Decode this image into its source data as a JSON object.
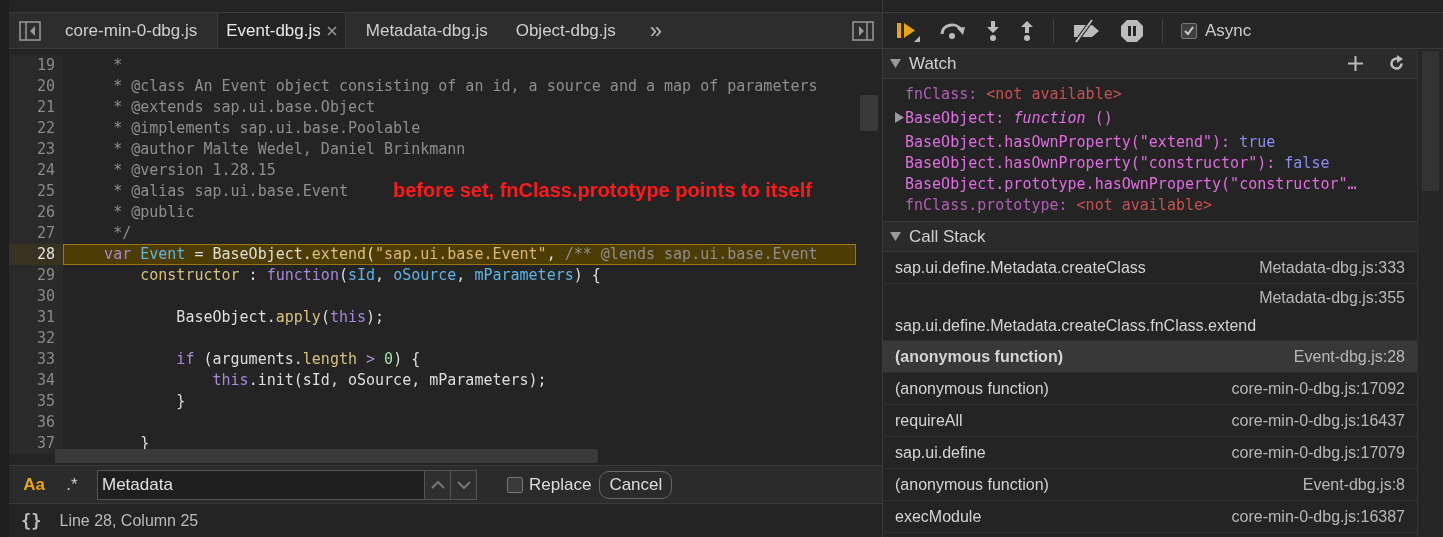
{
  "editor": {
    "tabs": [
      {
        "label": "core-min-0-dbg.js",
        "selected": false
      },
      {
        "label": "Event-dbg.js",
        "selected": true
      },
      {
        "label": "Metadata-dbg.js",
        "selected": false
      },
      {
        "label": "Object-dbg.js",
        "selected": false
      }
    ],
    "more_tabs": "»",
    "lines": [
      {
        "number": "19",
        "current": false,
        "tokens": [
          {
            "kind": "comment",
            "t": "     *"
          }
        ]
      },
      {
        "number": "20",
        "current": false,
        "tokens": [
          {
            "kind": "comment",
            "t": "     * @class An Event object consisting of an id, a source and a map of parameters"
          }
        ]
      },
      {
        "number": "21",
        "current": false,
        "tokens": [
          {
            "kind": "comment",
            "t": "     * @extends sap.ui.base.Object"
          }
        ]
      },
      {
        "number": "22",
        "current": false,
        "tokens": [
          {
            "kind": "comment",
            "t": "     * @implements sap.ui.base.Poolable"
          }
        ]
      },
      {
        "number": "23",
        "current": false,
        "tokens": [
          {
            "kind": "comment",
            "t": "     * @author Malte Wedel, Daniel Brinkmann"
          }
        ]
      },
      {
        "number": "24",
        "current": false,
        "tokens": [
          {
            "kind": "comment",
            "t": "     * @version 1.28.15"
          }
        ]
      },
      {
        "number": "25",
        "current": false,
        "tokens": [
          {
            "kind": "comment",
            "t": "     * @alias sap.ui.base.Event"
          }
        ]
      },
      {
        "number": "26",
        "current": false,
        "tokens": [
          {
            "kind": "comment",
            "t": "     * @public"
          }
        ]
      },
      {
        "number": "27",
        "current": false,
        "tokens": [
          {
            "kind": "comment",
            "t": "     */"
          }
        ]
      },
      {
        "number": "28",
        "current": true,
        "tokens": [
          {
            "kind": "keyword",
            "t": "    var "
          },
          {
            "kind": "ident",
            "t": "Event"
          },
          {
            "kind": "plain",
            "t": " = BaseObject."
          },
          {
            "kind": "prop",
            "t": "extend"
          },
          {
            "kind": "plain",
            "t": "("
          },
          {
            "kind": "string",
            "t": "\"sap.ui.base.Event\""
          },
          {
            "kind": "plain",
            "t": ", "
          },
          {
            "kind": "comment",
            "t": "/** @lends sap.ui.base.Event"
          }
        ]
      },
      {
        "number": "29",
        "current": false,
        "tokens": [
          {
            "kind": "prop",
            "t": "        constructor"
          },
          {
            "kind": "plain",
            "t": " : "
          },
          {
            "kind": "keyword",
            "t": "function"
          },
          {
            "kind": "plain",
            "t": "("
          },
          {
            "kind": "ident",
            "t": "sId"
          },
          {
            "kind": "plain",
            "t": ", "
          },
          {
            "kind": "ident",
            "t": "oSource"
          },
          {
            "kind": "plain",
            "t": ", "
          },
          {
            "kind": "ident",
            "t": "mParameters"
          },
          {
            "kind": "plain",
            "t": ") {"
          }
        ]
      },
      {
        "number": "30",
        "current": false
      },
      {
        "number": "31",
        "current": false,
        "tokens": [
          {
            "kind": "plain",
            "t": "            BaseObject."
          },
          {
            "kind": "prop",
            "t": "apply"
          },
          {
            "kind": "plain",
            "t": "("
          },
          {
            "kind": "keyword",
            "t": "this"
          },
          {
            "kind": "plain",
            "t": ");"
          }
        ]
      },
      {
        "number": "32",
        "current": false
      },
      {
        "number": "33",
        "current": false,
        "tokens": [
          {
            "kind": "keyword",
            "t": "            if"
          },
          {
            "kind": "plain",
            "t": " (arguments."
          },
          {
            "kind": "prop",
            "t": "length"
          },
          {
            "kind": "keyword",
            "t": " > "
          },
          {
            "kind": "number",
            "t": "0"
          },
          {
            "kind": "plain",
            "t": ") {"
          }
        ]
      },
      {
        "number": "34",
        "current": false,
        "tokens": [
          {
            "kind": "keyword",
            "t": "                this"
          },
          {
            "kind": "plain",
            "t": ".init(sId, oSource, mParameters);"
          }
        ]
      },
      {
        "number": "35",
        "current": false,
        "tokens": [
          {
            "kind": "plain",
            "t": "            }"
          }
        ]
      },
      {
        "number": "36",
        "current": false
      },
      {
        "number": "37",
        "current": false,
        "tokens": [
          {
            "kind": "plain",
            "t": "        }"
          }
        ]
      }
    ],
    "annotation": "before set, fnClass.prototype points to itself",
    "search": {
      "match_case": {
        "label": "Aa",
        "on": true
      },
      "regex": {
        "label": ".*",
        "on": false
      },
      "value": "Metadata",
      "replace": {
        "label": "Replace",
        "checked": false
      },
      "cancel": "Cancel"
    },
    "status": {
      "format": "{}",
      "position": "Line 28, Column 25"
    }
  },
  "debugger": {
    "async": {
      "label": "Async",
      "checked": true
    },
    "watch": {
      "title": "Watch",
      "items": [
        {
          "kind": "unavailable",
          "name": "fnClass:",
          "value": "<not available>",
          "expandable": false
        },
        {
          "kind": "value",
          "name": "BaseObject:",
          "value": "*function* ()",
          "expandable": true
        },
        {
          "kind": "value",
          "name": "BaseObject.hasOwnProperty(\"extend\"):",
          "value": "true",
          "expandable": false
        },
        {
          "kind": "value",
          "name": "BaseObject.hasOwnProperty(\"constructor\"):",
          "value": "false",
          "expandable": false
        },
        {
          "kind": "truncated",
          "name": "BaseObject.prototype.hasOwnProperty(\"constructor\"…",
          "expandable": false
        },
        {
          "kind": "unavailable",
          "name": "fnClass.prototype:",
          "value": "<not available>",
          "expandable": false
        }
      ]
    },
    "call_stack": {
      "title": "Call Stack",
      "frames": [
        {
          "name": "sap.ui.define.Metadata.createClass",
          "location": "Metadata-dbg.js:333",
          "selected": false
        },
        {
          "name": "sap.ui.define.Metadata.createClass.fnClass.extend",
          "location": "Metadata-dbg.js:355",
          "selected": false
        },
        {
          "name": "(anonymous function)",
          "location": "Event-dbg.js:28",
          "selected": true
        },
        {
          "name": "(anonymous function)",
          "location": "core-min-0-dbg.js:17092",
          "selected": false
        },
        {
          "name": "requireAll",
          "location": "core-min-0-dbg.js:16437",
          "selected": false
        },
        {
          "name": "sap.ui.define",
          "location": "core-min-0-dbg.js:17079",
          "selected": false
        },
        {
          "name": "(anonymous function)",
          "location": "Event-dbg.js:8",
          "selected": false
        },
        {
          "name": "execModule",
          "location": "core-min-0-dbg.js:16387",
          "selected": false
        }
      ]
    }
  }
}
